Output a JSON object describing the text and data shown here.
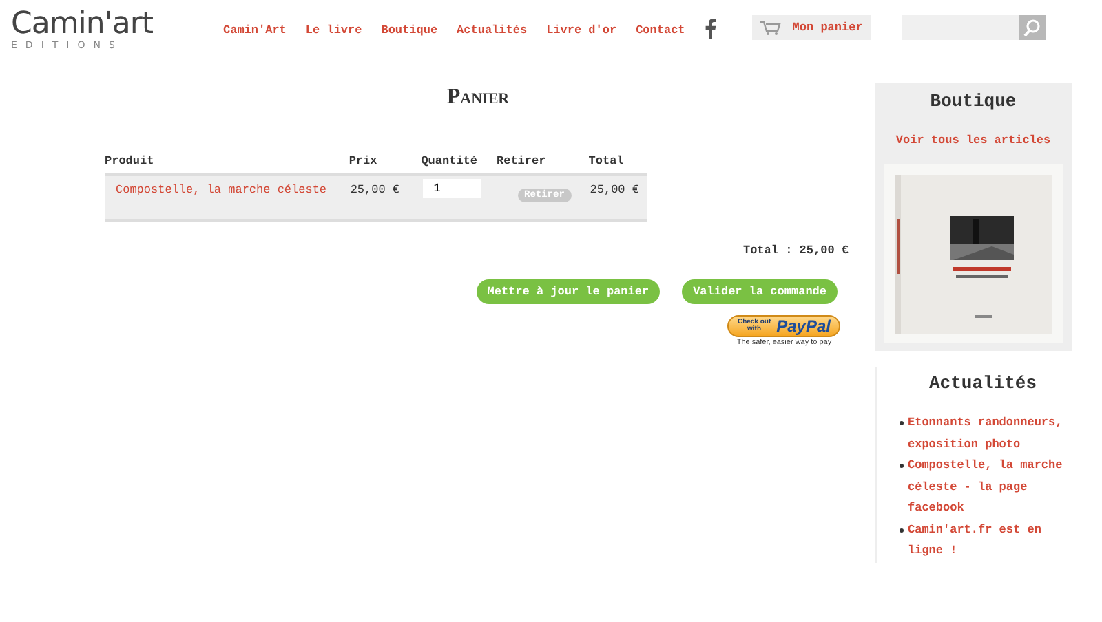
{
  "logo": {
    "name": "Camin'art",
    "subtitle": "EDITIONS"
  },
  "nav": [
    {
      "label": "Camin'Art"
    },
    {
      "label": "Le livre"
    },
    {
      "label": "Boutique"
    },
    {
      "label": "Actualités"
    },
    {
      "label": "Livre d'or"
    },
    {
      "label": "Contact"
    }
  ],
  "cart_link": {
    "label": "Mon panier"
  },
  "page_title": "Panier",
  "cart": {
    "columns": [
      "Produit",
      "Prix",
      "Quantité",
      "Retirer",
      "Total"
    ],
    "rows": [
      {
        "product": "Compostelle, la marche céleste",
        "price": "25,00 €",
        "quantity": "1",
        "remove": "Retirer",
        "total": "25,00 €"
      }
    ],
    "grand_total": "Total : 25,00 €"
  },
  "buttons": [
    "Mettre à jour le panier",
    "Valider la commande"
  ],
  "paypal": {
    "top": "Check out",
    "bottom": "with",
    "brand": "PayPal",
    "tagline": "The safer, easier way to pay"
  },
  "sidebar": {
    "shop": {
      "title": "Boutique",
      "link": "Voir tous les articles"
    },
    "news": {
      "title": "Actualités",
      "items": [
        "Etonnants randonneurs, exposition photo",
        "Compostelle, la marche céleste - la page facebook",
        "Camin'art.fr est en ligne !"
      ]
    }
  }
}
